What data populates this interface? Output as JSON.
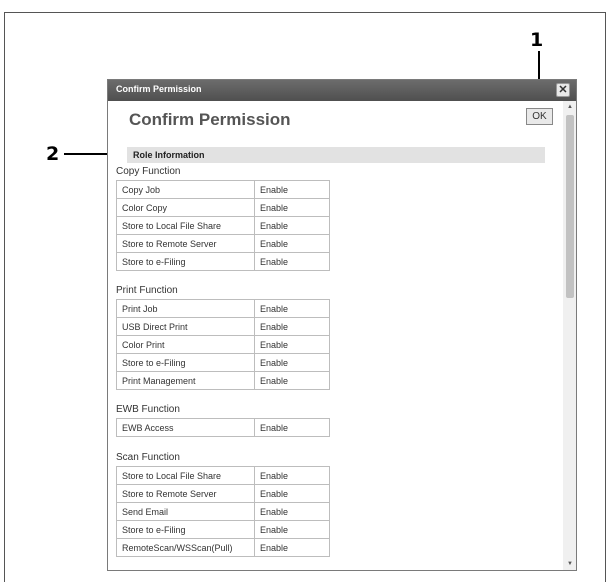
{
  "callouts": {
    "one": "1",
    "two": "2"
  },
  "dialog": {
    "title": "Confirm Permission",
    "close_icon": "close-icon",
    "heading": "Confirm Permission",
    "ok_label": "OK",
    "section_title": "Role Information"
  },
  "groups": [
    {
      "label": "Copy Function",
      "rows": [
        {
          "name": "Copy Job",
          "value": "Enable"
        },
        {
          "name": "Color Copy",
          "value": "Enable"
        },
        {
          "name": "Store to Local File Share",
          "value": "Enable"
        },
        {
          "name": "Store to Remote Server",
          "value": "Enable"
        },
        {
          "name": "Store to e-Filing",
          "value": "Enable"
        }
      ]
    },
    {
      "label": "Print Function",
      "rows": [
        {
          "name": "Print Job",
          "value": "Enable"
        },
        {
          "name": "USB Direct Print",
          "value": "Enable"
        },
        {
          "name": "Color Print",
          "value": "Enable"
        },
        {
          "name": "Store to e-Filing",
          "value": "Enable"
        },
        {
          "name": "Print Management",
          "value": "Enable"
        }
      ]
    },
    {
      "label": "EWB Function",
      "rows": [
        {
          "name": "EWB Access",
          "value": "Enable"
        }
      ]
    },
    {
      "label": "Scan Function",
      "rows": [
        {
          "name": "Store to Local File Share",
          "value": "Enable"
        },
        {
          "name": "Store to Remote Server",
          "value": "Enable"
        },
        {
          "name": "Send Email",
          "value": "Enable"
        },
        {
          "name": "Store to e-Filing",
          "value": "Enable"
        },
        {
          "name": "RemoteScan/WSScan(Pull)",
          "value": "Enable"
        }
      ]
    }
  ]
}
